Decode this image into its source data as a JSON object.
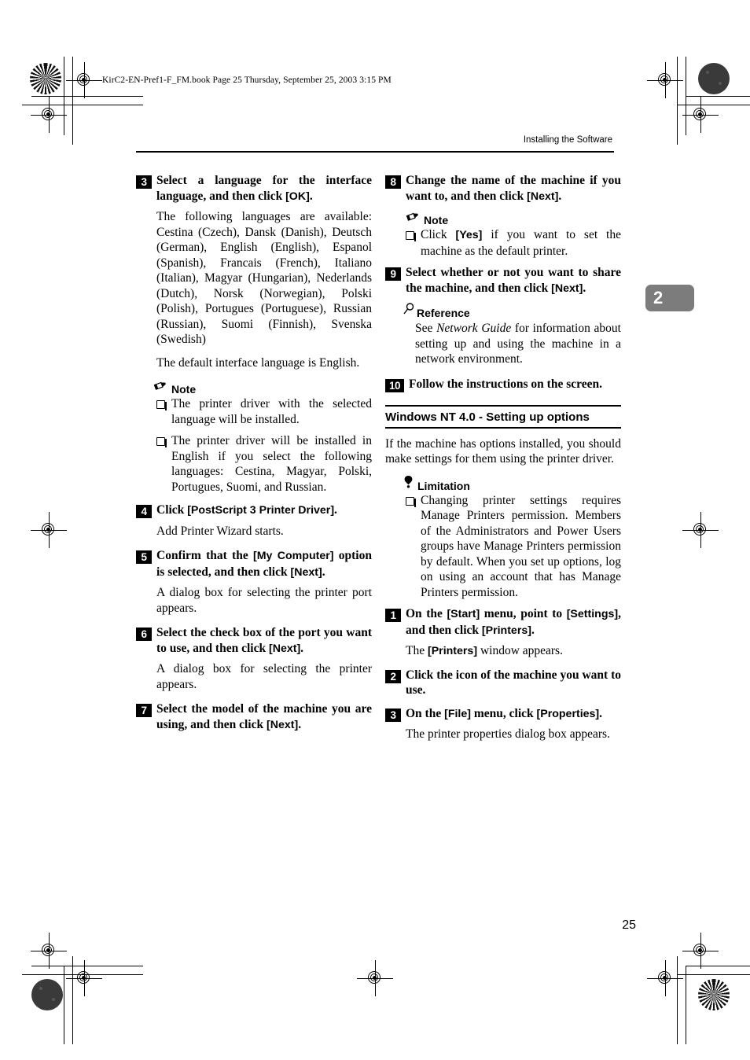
{
  "print_marks": {
    "file_strip": "KirC2-EN-Pref1-F_FM.book  Page 25  Thursday, September 25, 2003  3:15 PM"
  },
  "header": {
    "running_head": "Installing the Software",
    "chapter_tab": "2"
  },
  "footer": {
    "page_number": "25"
  },
  "left_column": {
    "step3": {
      "number": "3",
      "title_parts": [
        {
          "t": "Select a language for the interface language, and then click ",
          "ui": false
        },
        {
          "t": "[OK]",
          "ui": true
        },
        {
          "t": ".",
          "ui": false
        }
      ],
      "title_plain": "Select a language for the interface language, and then click [OK].",
      "body1": "The following languages are available: Cestina (Czech), Dansk (Danish), Deutsch (German), English (English), Espanol (Spanish), Francais (French), Italiano (Italian), Magyar (Hungarian), Nederlands (Dutch), Norsk (Norwegian), Polski (Polish), Portugues (Portuguese), Russian (Russian), Suomi (Finnish), Svenska (Swedish)",
      "body2": "The default interface language is English.",
      "note_label": "Note",
      "note_items": [
        "The printer driver with the selected language will be installed.",
        "The printer driver will be installed in English if you select the following languages: Cestina, Magyar, Polski, Portugues, Suomi, and Russian."
      ]
    },
    "step4": {
      "number": "4",
      "title_plain": "Click [PostScript 3 Printer Driver].",
      "body": "Add Printer Wizard starts."
    },
    "step5": {
      "number": "5",
      "title_plain": "Confirm that the [My Computer] option is selected, and then click [Next].",
      "body": "A dialog box for selecting the printer port appears."
    },
    "step6": {
      "number": "6",
      "title_plain": "Select the check box of the port you want to use, and then click [Next].",
      "body": "A dialog box for selecting the printer appears."
    },
    "step7": {
      "number": "7",
      "title_plain": "Select the model of the machine you are using, and then click [Next]."
    }
  },
  "right_column": {
    "step8": {
      "number": "8",
      "title_plain": "Change the name of the machine if you want to, and then click [Next].",
      "note_label": "Note",
      "note_items": [
        "Click [Yes] if you want to set the machine as the default printer."
      ]
    },
    "step9": {
      "number": "9",
      "title_plain": "Select whether or not you want to share the machine, and then click [Next].",
      "reference_label": "Reference",
      "reference_body": "See Network Guide for information about setting up and using the machine in a network environment.",
      "reference_italic": "Network Guide"
    },
    "step10": {
      "number": "10",
      "title_plain": "Follow the instructions on the screen."
    },
    "section": {
      "heading": "Windows NT 4.0 - Setting up options",
      "intro": "If the machine has options installed, you should make settings for them using the printer driver.",
      "limitation_label": "Limitation",
      "limitation_items": [
        "Changing printer settings requires Manage Printers permission. Members of the Administrators and Power Users groups have Manage Printers permission by default. When you set up options, log on using an account that has Manage Printers permission."
      ],
      "step1": {
        "number": "1",
        "title_plain": "On the [Start] menu, point to [Settings], and then click [Printers].",
        "body_plain": "The [Printers] window appears."
      },
      "step2": {
        "number": "2",
        "title_plain": "Click the icon of the machine you want to use."
      },
      "step3": {
        "number": "3",
        "title_plain": "On the [File] menu, click [Properties].",
        "body": "The printer properties dialog box appears."
      }
    }
  },
  "icons": {
    "note": "pencil-icon",
    "reference": "magnifier-icon",
    "limitation": "pushpin-icon",
    "bullet": "checkbox-bullet-icon"
  }
}
